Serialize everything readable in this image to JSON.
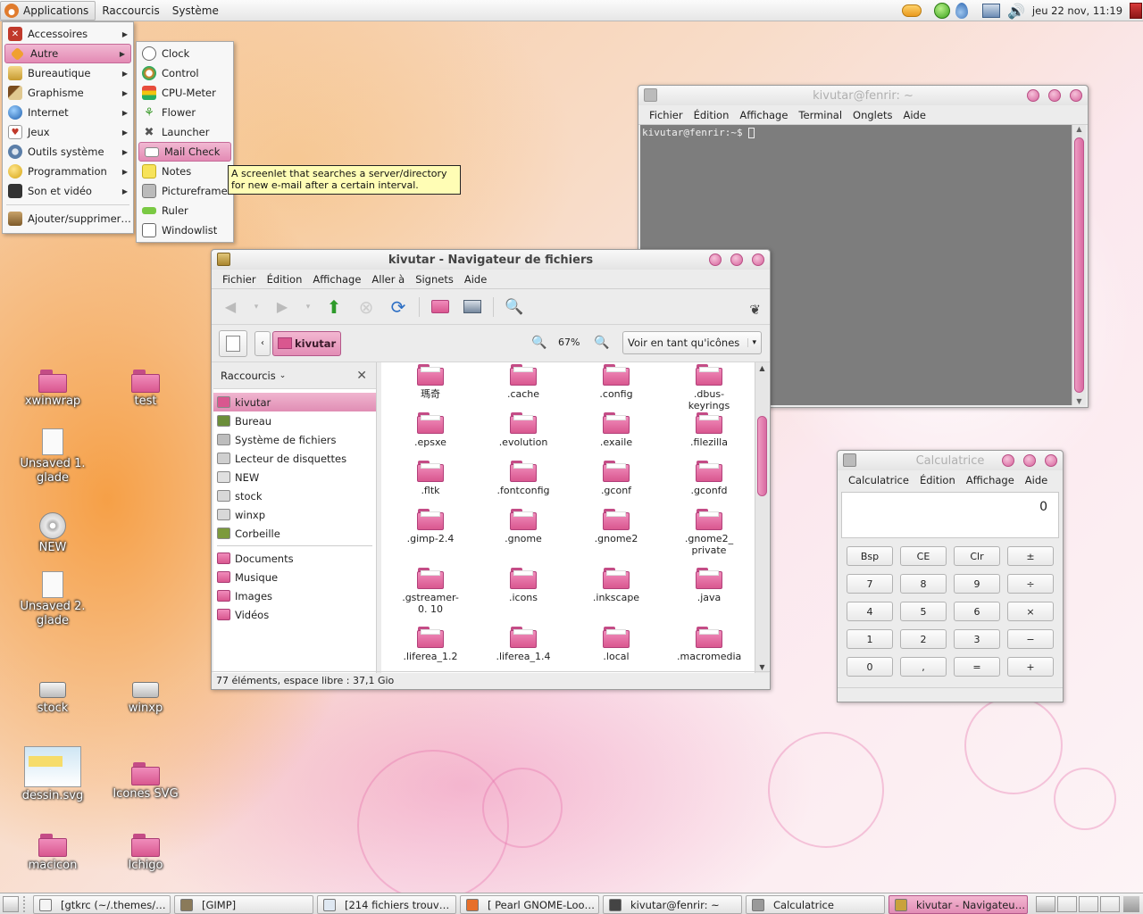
{
  "top_panel": {
    "menus": [
      "Applications",
      "Raccourcis",
      "Système"
    ],
    "clock": "jeu 22 nov, 11:19"
  },
  "app_menu": {
    "items": [
      {
        "label": "Accessoires",
        "icon": "accessories-icon",
        "submenu": true
      },
      {
        "label": "Autre",
        "icon": "other-icon",
        "submenu": true,
        "selected": true
      },
      {
        "label": "Bureautique",
        "icon": "office-icon",
        "submenu": true
      },
      {
        "label": "Graphisme",
        "icon": "graphics-icon",
        "submenu": true
      },
      {
        "label": "Internet",
        "icon": "internet-icon",
        "submenu": true
      },
      {
        "label": "Jeux",
        "icon": "games-icon",
        "submenu": true
      },
      {
        "label": "Outils système",
        "icon": "system-tools-icon",
        "submenu": true
      },
      {
        "label": "Programmation",
        "icon": "programming-icon",
        "submenu": true
      },
      {
        "label": "Son et vidéo",
        "icon": "multimedia-icon",
        "submenu": true
      }
    ],
    "footer": "Ajouter/supprimer…"
  },
  "sub_menu": {
    "items": [
      "Clock",
      "Control",
      "CPU-Meter",
      "Flower",
      "Launcher",
      "Mail Check",
      "Notes",
      "Pictureframe",
      "Ruler",
      "Windowlist"
    ],
    "selected": "Mail Check"
  },
  "tooltip": {
    "line1": "A screenlet that searches a server/directory",
    "line2": "for new e-mail after a certain interval."
  },
  "terminal": {
    "title": "kivutar@fenrir: ~",
    "menus": [
      "Fichier",
      "Édition",
      "Affichage",
      "Terminal",
      "Onglets",
      "Aide"
    ],
    "prompt": "kivutar@fenrir:~$ "
  },
  "file_manager": {
    "title": "kivutar - Navigateur de fichiers",
    "menus": [
      "Fichier",
      "Édition",
      "Affichage",
      "Aller à",
      "Signets",
      "Aide"
    ],
    "location": "kivutar",
    "zoom": "67%",
    "view_mode": "Voir en tant qu'icônes",
    "sidebar_title": "Raccourcis",
    "places": [
      "kivutar",
      "Bureau",
      "Système de fichiers",
      "Lecteur de disquettes",
      "NEW",
      "stock",
      "winxp",
      "Corbeille"
    ],
    "bookmarks": [
      "Documents",
      "Musique",
      "Images",
      "Vidéos"
    ],
    "files": [
      "瑪奇",
      ".cache",
      ".config",
      ".dbus-keyrings",
      ".epsxe",
      ".evolution",
      ".exaile",
      ".filezilla",
      ".fltk",
      ".fontconfig",
      ".gconf",
      ".gconfd",
      ".gimp-2.4",
      ".gnome",
      ".gnome2",
      ".gnome2_ private",
      ".gstreamer-0. 10",
      ".icons",
      ".inkscape",
      ".java",
      ".liferea_1.2",
      ".liferea_1.4",
      ".local",
      ".macromedia"
    ],
    "status": "77 éléments, espace libre : 37,1 Gio"
  },
  "calculator": {
    "title": "Calculatrice",
    "menus": [
      "Calculatrice",
      "Édition",
      "Affichage",
      "Aide"
    ],
    "display": "0",
    "buttons": [
      [
        "Bsp",
        "CE",
        "Clr",
        "±"
      ],
      [
        "7",
        "8",
        "9",
        "÷"
      ],
      [
        "4",
        "5",
        "6",
        "×"
      ],
      [
        "1",
        "2",
        "3",
        "−"
      ],
      [
        "0",
        ",",
        "=",
        "+"
      ]
    ]
  },
  "desktop_icons": [
    {
      "label": "xwinwrap",
      "kind": "folder"
    },
    {
      "label": "test",
      "kind": "folder"
    },
    {
      "label": "Unsaved 1. glade",
      "kind": "document"
    },
    {
      "label": "NEW",
      "kind": "cdrom"
    },
    {
      "label": "Unsaved 2. glade",
      "kind": "document"
    },
    {
      "label": "stock",
      "kind": "drive"
    },
    {
      "label": "winxp",
      "kind": "drive"
    },
    {
      "label": "dessin.svg",
      "kind": "image"
    },
    {
      "label": "Icones SVG",
      "kind": "folder"
    },
    {
      "label": "macicon",
      "kind": "folder"
    },
    {
      "label": "Ichigo",
      "kind": "folder"
    }
  ],
  "taskbar": [
    {
      "label": "[gtkrc (~/.themes/…",
      "active": false
    },
    {
      "label": "[GIMP]",
      "active": false
    },
    {
      "label": "[214 fichiers trouv…",
      "active": false
    },
    {
      "label": "[ Pearl GNOME-Loo…",
      "active": false
    },
    {
      "label": "kivutar@fenrir: ~",
      "active": false
    },
    {
      "label": "Calculatrice",
      "active": false
    },
    {
      "label": "kivutar - Navigateu…",
      "active": true
    }
  ],
  "colors": {
    "accent": "#e38ab4",
    "accent_dark": "#c44c86",
    "terminal_bg": "#7d7d7d",
    "tooltip_bg": "#fffdb5"
  }
}
